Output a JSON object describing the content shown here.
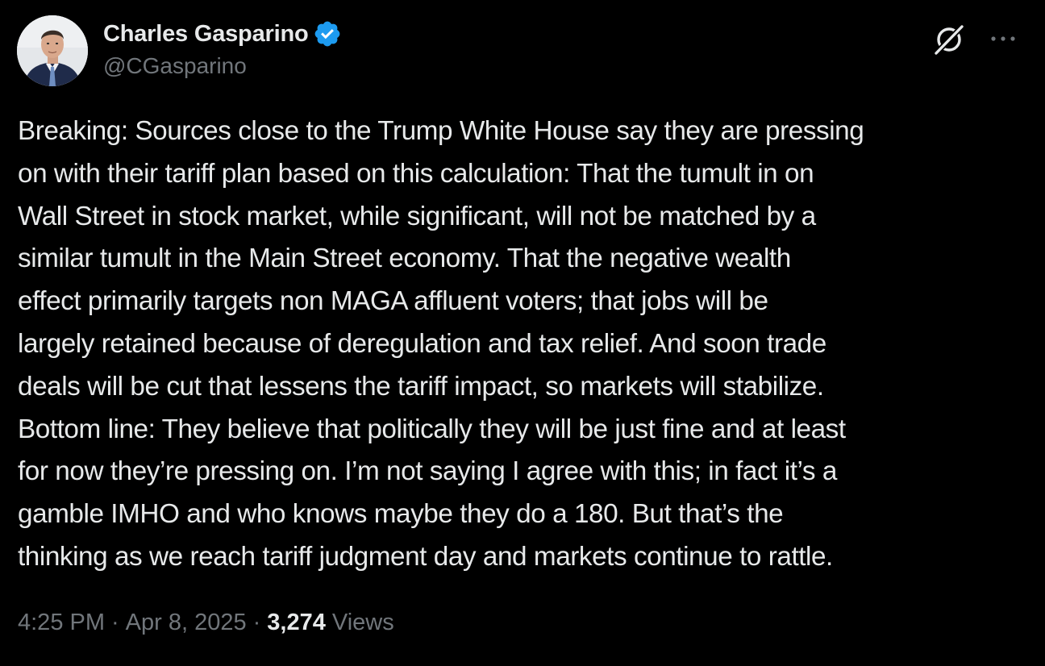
{
  "author": {
    "display_name": "Charles Gasparino",
    "handle": "@CGasparino",
    "verified": true,
    "verified_color": "#1d9bf0"
  },
  "header_icons": {
    "grok": "grok-icon",
    "more": "more-icon"
  },
  "tweet": {
    "text": "Breaking: Sources close to the Trump White House say they are pressing\non with their tariff plan based on this calculation: That the tumult in on\nWall Street in stock market, while significant, will not be matched by a\nsimilar tumult in the Main Street economy. That the negative wealth\neffect primarily targets non MAGA affluent voters; that jobs will be\nlargely retained because of deregulation and tax relief. And soon trade\ndeals will be cut that lessens the tariff impact, so markets will stabilize.\nBottom line: They believe that politically they will be just fine and at least\nfor now they’re pressing on. I’m not saying I agree with this; in fact it’s a\ngamble IMHO and who knows maybe they do a 180. But that’s the\nthinking as we reach tariff judgment day and markets continue to rattle.",
    "time": "4:25 PM",
    "separator": "·",
    "date": "Apr 8, 2025",
    "views_count": "3,274",
    "views_label": "Views"
  },
  "colors": {
    "background": "#000000",
    "primary_text": "#e7e9ea",
    "secondary_text": "#71767b",
    "accent": "#1d9bf0"
  }
}
